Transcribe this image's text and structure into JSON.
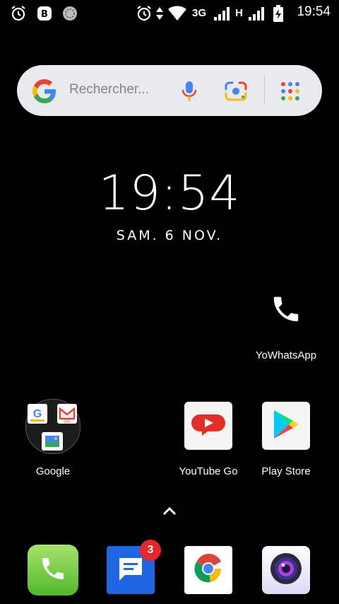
{
  "status_bar": {
    "network_type": "3G",
    "network_type_2": "H",
    "time": "19:54"
  },
  "search": {
    "placeholder": "Rechercher..."
  },
  "clock": {
    "time": "19:54",
    "date": "SAM. 6 NOV."
  },
  "apps": {
    "yowhatsapp": "YoWhatsApp",
    "google": "Google",
    "youtube_go": "YouTube Go",
    "play_store": "Play Store"
  },
  "dock": {
    "messages_badge": "3"
  },
  "colors": {
    "background": "#000000",
    "search_bg": "#e8eaed",
    "badge": "#e8252a"
  }
}
